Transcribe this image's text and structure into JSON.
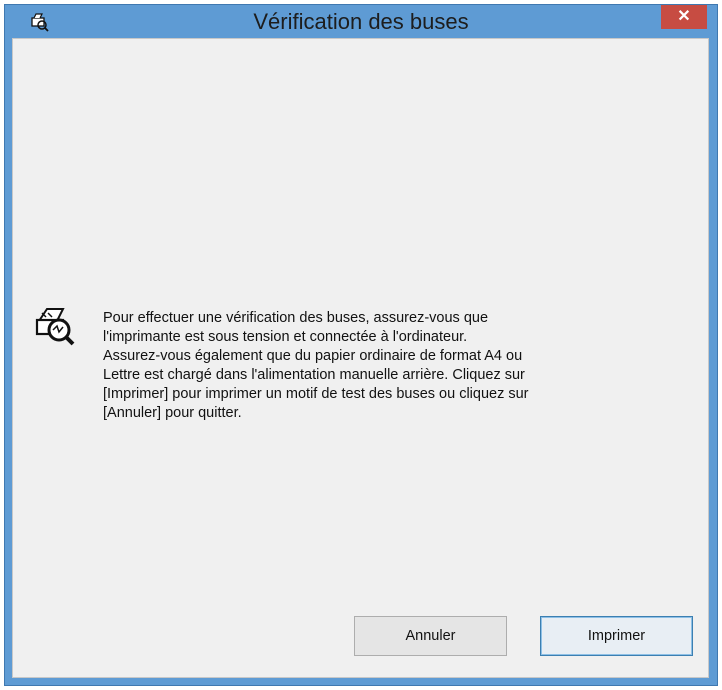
{
  "window": {
    "title": "Vérification des buses",
    "close_label": "✕"
  },
  "message": {
    "lines": [
      "Pour effectuer une vérification des buses, assurez-vous que",
      "l'imprimante est sous tension et connectée à l'ordinateur.",
      "Assurez-vous également que du papier ordinaire de format A4 ou",
      "Lettre est chargé dans l'alimentation manuelle arrière. Cliquez sur",
      "[Imprimer] pour imprimer un motif de test des buses ou cliquez sur",
      "[Annuler] pour quitter."
    ]
  },
  "buttons": {
    "cancel_label": "Annuler",
    "print_label": "Imprimer"
  },
  "icons": {
    "title": "printer-nozzle-check-icon",
    "message": "nozzle-check-magnifier-icon"
  },
  "colors": {
    "titlebar": "#5e9bd4",
    "close": "#c74c42",
    "client": "#f0f0f0"
  }
}
